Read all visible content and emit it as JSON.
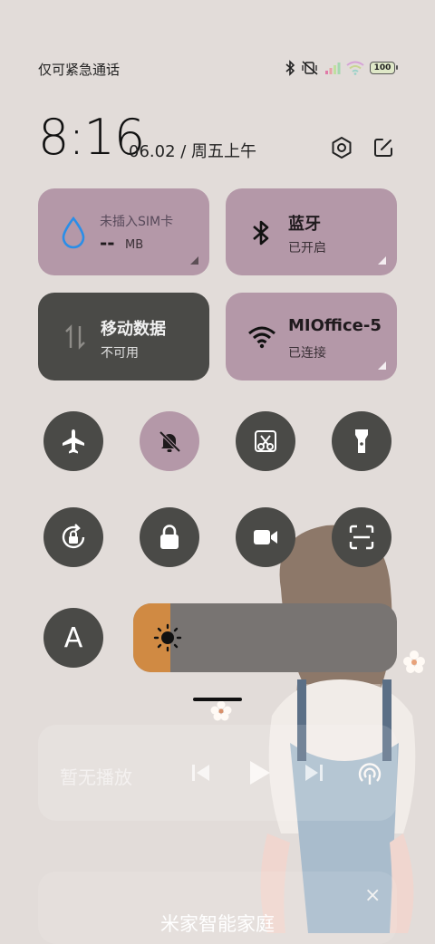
{
  "status_bar": {
    "carrier_text": "仅可紧急通话",
    "battery_level": "100",
    "icons": [
      "bluetooth-icon",
      "mute-vibrate-icon",
      "signal-icon",
      "wifi-icon",
      "battery-icon"
    ]
  },
  "header": {
    "time": "8:16",
    "date": "06.02 / 周五上午",
    "icons": [
      "settings-icon",
      "edit-icon"
    ]
  },
  "tiles": {
    "data_usage": {
      "title": "未插入SIM卡",
      "value": "--",
      "unit": "MB",
      "icon": "water-drop-icon"
    },
    "bluetooth": {
      "title": "蓝牙",
      "status": "已开启",
      "icon": "bluetooth-icon"
    },
    "mobile_data": {
      "title": "移动数据",
      "status": "不可用",
      "icon": "data-arrows-icon"
    },
    "wifi": {
      "title": "MIOffice-5",
      "status": "已连接",
      "icon": "wifi-icon"
    }
  },
  "toggles": {
    "row1": [
      {
        "name": "airplane-mode",
        "icon": "airplane-icon",
        "on": false
      },
      {
        "name": "mute",
        "icon": "bell-off-icon",
        "on": true
      },
      {
        "name": "screenshot",
        "icon": "scissors-icon",
        "on": false
      },
      {
        "name": "flashlight",
        "icon": "flashlight-icon",
        "on": false
      }
    ],
    "row2": [
      {
        "name": "auto-rotate",
        "icon": "rotate-lock-icon",
        "on": false
      },
      {
        "name": "lock-screen",
        "icon": "lock-icon",
        "on": false
      },
      {
        "name": "screen-record",
        "icon": "video-icon",
        "on": false
      },
      {
        "name": "scanner",
        "icon": "scan-icon",
        "on": false
      }
    ],
    "auto_brightness_label": "A"
  },
  "brightness": {
    "level": 0.14,
    "icon": "sun-icon",
    "fill_color": "#d08a43"
  },
  "media": {
    "label": "暂无播放"
  },
  "bottom": {
    "label": "米家智能家庭",
    "close": "×"
  },
  "colors": {
    "accent_purple": "#b498a8",
    "tile_dark": "#4a4a47",
    "background": "#e2dcd9"
  }
}
